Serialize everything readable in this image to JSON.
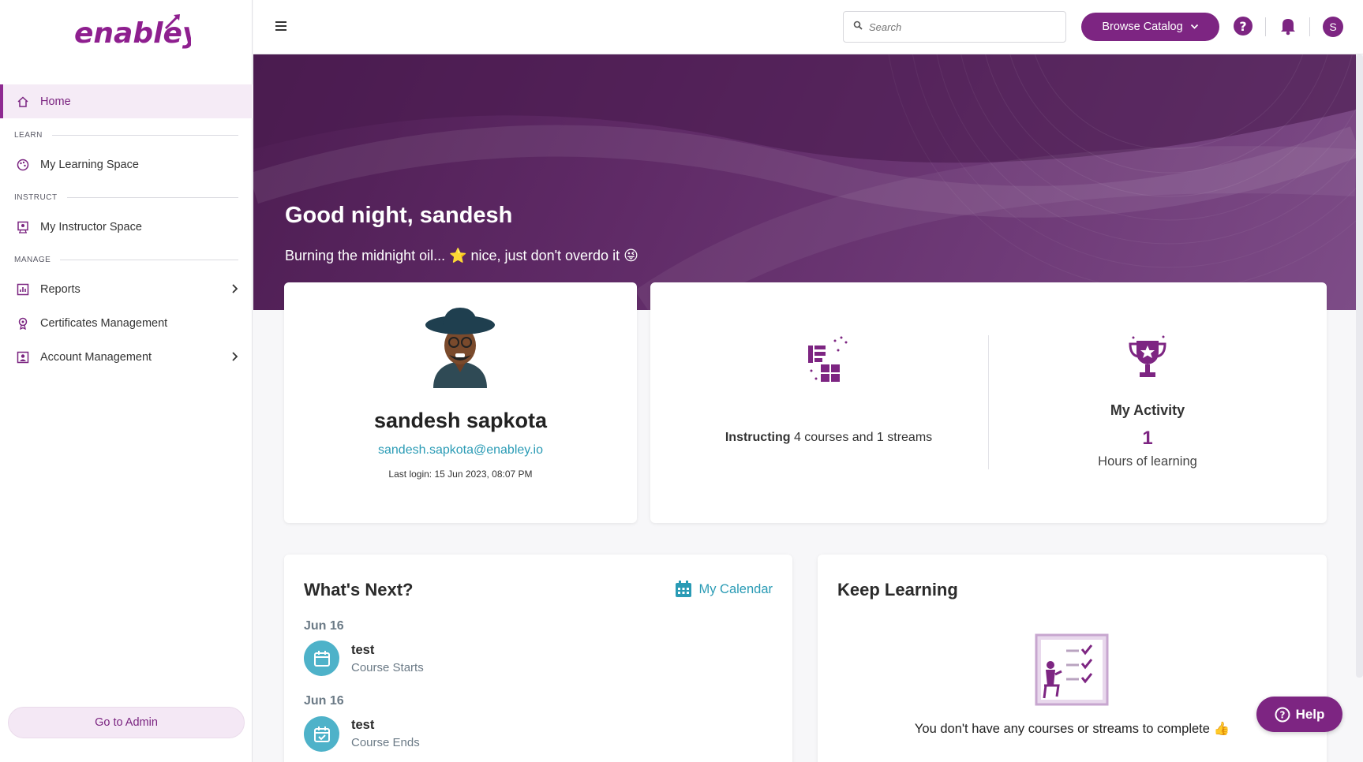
{
  "app": {
    "logo": "enabley"
  },
  "sidebar": {
    "home_label": "Home",
    "sections": {
      "learn": "LEARN",
      "instruct": "INSTRUCT",
      "manage": "MANAGE"
    },
    "items": {
      "learning_space": "My Learning Space",
      "instructor_space": "My Instructor Space",
      "reports": "Reports",
      "certificates": "Certificates Management",
      "account": "Account Management"
    },
    "admin_button": "Go to Admin"
  },
  "topbar": {
    "search_placeholder": "Search",
    "browse_label": "Browse Catalog",
    "avatar_initial": "S"
  },
  "hero": {
    "greeting": "Good night, sandesh",
    "subtitle": "Burning the midnight oil... ⭐ nice, just don't overdo it 😜"
  },
  "profile": {
    "name": "sandesh sapkota",
    "email": "sandesh.sapkota@enabley.io",
    "last_login": "Last login: 15 Jun 2023, 08:07 PM"
  },
  "stats": {
    "instructing_bold": "Instructing",
    "instructing_rest": " 4 courses and 1 streams",
    "activity_title": "My Activity",
    "activity_value": "1",
    "activity_label": "Hours of learning"
  },
  "whats_next": {
    "title": "What's Next?",
    "calendar_link": "My Calendar",
    "events": [
      {
        "date": "Jun 16",
        "name": "test",
        "type": "Course Starts"
      },
      {
        "date": "Jun 16",
        "name": "test",
        "type": "Course Ends"
      }
    ]
  },
  "keep_learning": {
    "title": "Keep Learning",
    "empty_text": "You don't have any courses or streams to complete 👍"
  },
  "help_label": "Help",
  "colors": {
    "brand": "#7d2582",
    "accent_teal": "#2a9bb5",
    "hero": "#5f2a66"
  }
}
